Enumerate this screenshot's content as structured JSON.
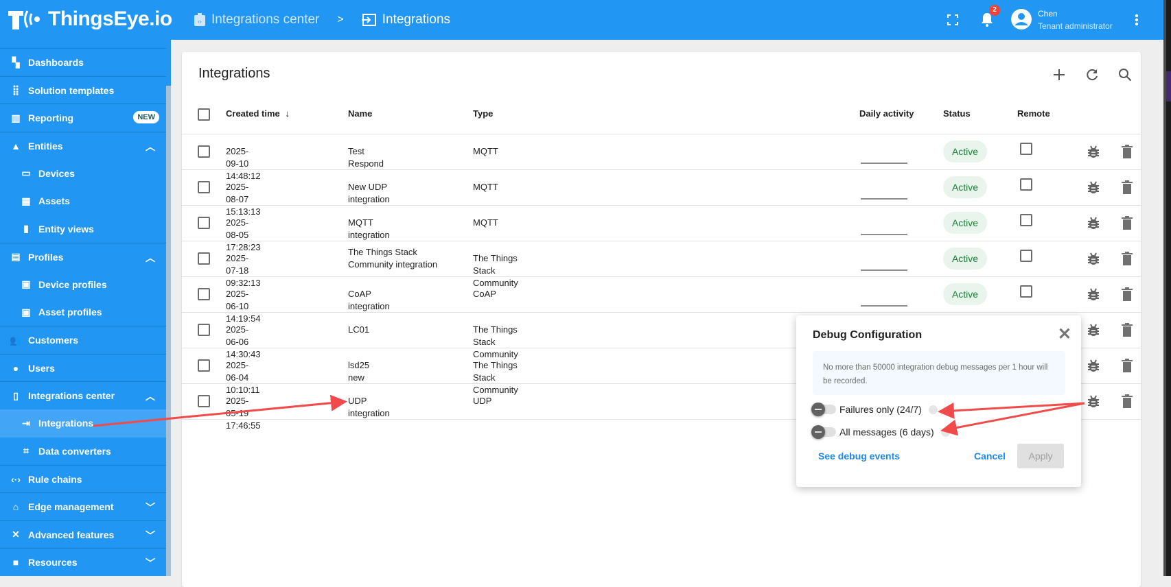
{
  "app": {
    "logo_text": "ThingsEye.io"
  },
  "breadcrumb": {
    "parent": "Integrations center",
    "separator": ">",
    "current": "Integrations"
  },
  "header": {
    "notifications_count": "2",
    "user_name": "Chen",
    "user_role": "Tenant administrator"
  },
  "sidebar": {
    "items": [
      {
        "label": "Dashboards",
        "icon": "dashboard-icon",
        "top": true
      },
      {
        "label": "Solution templates",
        "icon": "grid-icon",
        "top": true
      },
      {
        "label": "Reporting",
        "icon": "reporting-icon",
        "top": true,
        "badge": "NEW"
      },
      {
        "label": "Entities",
        "icon": "entities-icon",
        "top": true,
        "chevron": "up"
      },
      {
        "label": "Devices",
        "icon": "devices-icon",
        "sub": true
      },
      {
        "label": "Assets",
        "icon": "assets-icon",
        "sub": true
      },
      {
        "label": "Entity views",
        "icon": "entity-views-icon",
        "sub": true
      },
      {
        "label": "Profiles",
        "icon": "profiles-icon",
        "top": true,
        "chevron": "up"
      },
      {
        "label": "Device profiles",
        "icon": "device-profile-icon",
        "sub": true
      },
      {
        "label": "Asset profiles",
        "icon": "asset-profile-icon",
        "sub": true
      },
      {
        "label": "Customers",
        "icon": "customers-icon",
        "top": true
      },
      {
        "label": "Users",
        "icon": "user-icon",
        "top": true
      },
      {
        "label": "Integrations center",
        "icon": "integrations-center-icon",
        "top": true,
        "chevron": "up"
      },
      {
        "label": "Integrations",
        "icon": "integrations-icon",
        "sub": true,
        "selected": true
      },
      {
        "label": "Data converters",
        "icon": "data-converters-icon",
        "sub": true
      },
      {
        "label": "Rule chains",
        "icon": "rule-chains-icon",
        "top": true
      },
      {
        "label": "Edge management",
        "icon": "edge-icon",
        "top": true,
        "chevron": "down"
      },
      {
        "label": "Advanced features",
        "icon": "tools-icon",
        "top": true,
        "chevron": "down"
      },
      {
        "label": "Resources",
        "icon": "folder-icon",
        "top": true,
        "chevron": "down"
      }
    ]
  },
  "main": {
    "title": "Integrations",
    "columns": {
      "created": "Created time",
      "name": "Name",
      "type": "Type",
      "daily": "Daily activity",
      "status": "Status",
      "remote": "Remote"
    },
    "rows": [
      {
        "created": "2025-09-10 14:48:12",
        "name": "Test Respond",
        "type": "MQTT",
        "status": "Active"
      },
      {
        "created": "2025-08-07 15:13:13",
        "name": "New UDP integration",
        "type": "MQTT",
        "status": "Active"
      },
      {
        "created": "2025-08-05 17:28:23",
        "name": "MQTT integration",
        "type": "MQTT",
        "status": "Active"
      },
      {
        "created": "2025-07-18 09:32:13",
        "name": "The Things Stack Community integration",
        "type": "The Things Stack Community",
        "status": "Active"
      },
      {
        "created": "2025-06-10 14:19:54",
        "name": "CoAP integration",
        "type": "CoAP",
        "status": "Active"
      },
      {
        "created": "2025-06-06 14:30:43",
        "name": "LC01",
        "type": "The Things Stack Community",
        "status": ""
      },
      {
        "created": "2025-06-04 10:10:11",
        "name": "lsd25 new",
        "type": "The Things Stack Community",
        "status": ""
      },
      {
        "created": "2025-05-19 17:46:55",
        "name": "UDP integration",
        "type": "UDP",
        "status": ""
      }
    ]
  },
  "dialog": {
    "title": "Debug Configuration",
    "info": "No more than 50000 integration debug messages per 1 hour will be recorded.",
    "failures_label": "Failures only (24/7)",
    "all_label": "All messages (6 days)",
    "see_events": "See debug events",
    "cancel": "Cancel",
    "apply": "Apply"
  },
  "colors": {
    "primary": "#2196f3",
    "active_text": "#198038",
    "active_bg": "#e9f4ec",
    "annotation_arrow": "#f04a4a"
  }
}
